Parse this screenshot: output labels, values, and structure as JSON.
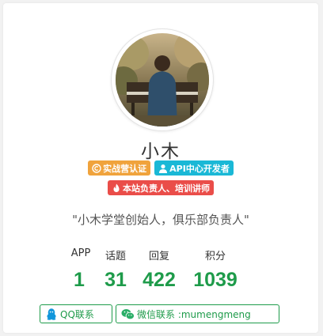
{
  "profile": {
    "name": "小木",
    "badges": [
      {
        "label": "实战营认证",
        "icon": "copyright-circle-icon",
        "color": "#f0a33c"
      },
      {
        "label": "API中心开发者",
        "icon": "user-icon",
        "color": "#1ab8d6"
      },
      {
        "label": "本站负责人、培训讲师",
        "icon": "fire-icon",
        "color": "#ea4d49"
      }
    ],
    "motto": "\"小木学堂创始人，俱乐部负责人\""
  },
  "stats": [
    {
      "label": "APP",
      "value": "1"
    },
    {
      "label": "话题",
      "value": "31"
    },
    {
      "label": "回复",
      "value": "422"
    },
    {
      "label": "积分",
      "value": "1039"
    }
  ],
  "contacts": {
    "qq_label": "QQ联系",
    "wechat_label": "微信联系 :mumengmeng"
  },
  "colors": {
    "accent_green": "#1e9b4a",
    "qq_blue": "#1296db",
    "wechat_green": "#2aae67"
  }
}
